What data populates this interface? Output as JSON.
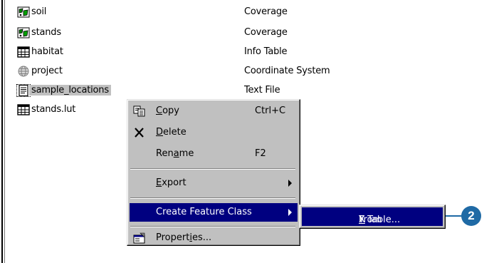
{
  "files": [
    {
      "name": "soil",
      "type": "Coverage",
      "icon": "coverage-icon"
    },
    {
      "name": "stands",
      "type": "Coverage",
      "icon": "coverage-icon"
    },
    {
      "name": "habitat",
      "type": "Info Table",
      "icon": "info-table-icon"
    },
    {
      "name": "project",
      "type": "Coordinate System",
      "icon": "globe-icon"
    },
    {
      "name": "sample_locations",
      "type": "Text File",
      "icon": "text-file-icon"
    },
    {
      "name": "stands.lut",
      "type": "",
      "icon": "info-table-icon"
    }
  ],
  "context_menu": {
    "copy": {
      "pre": "",
      "u": "C",
      "post": "opy",
      "shortcut": "Ctrl+C"
    },
    "delete": {
      "pre": "",
      "u": "D",
      "post": "elete"
    },
    "rename": {
      "pre": "Ren",
      "u": "a",
      "post": "me",
      "shortcut": "F2"
    },
    "export": {
      "pre": "",
      "u": "E",
      "post": "xport"
    },
    "create_feature_class": {
      "label": "Create Feature Class"
    },
    "properties": {
      "pre": "Propert",
      "u": "i",
      "post": "es..."
    }
  },
  "submenu": {
    "pre": "From ",
    "u": "X",
    "post": "Y Table..."
  },
  "callout": {
    "number": "2",
    "color": "#1f6aa5"
  },
  "colors": {
    "highlight": "#000080",
    "menu_bg": "#c0c0c0"
  }
}
